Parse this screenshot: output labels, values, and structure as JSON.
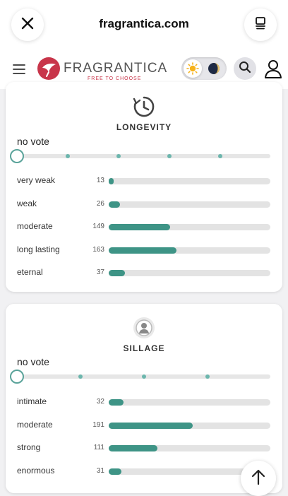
{
  "browser": {
    "url": "fragrantica.com"
  },
  "header": {
    "logo_text": "FRAGRANTICA",
    "logo_tagline": "FREE TO CHOOSE"
  },
  "longevity": {
    "title": "LONGEVITY",
    "vote_status": "no vote",
    "rows": [
      {
        "label": "very weak",
        "count": "13",
        "fraction": 0.03
      },
      {
        "label": "weak",
        "count": "26",
        "fraction": 0.07
      },
      {
        "label": "moderate",
        "count": "149",
        "fraction": 0.38
      },
      {
        "label": "long lasting",
        "count": "163",
        "fraction": 0.42
      },
      {
        "label": "eternal",
        "count": "37",
        "fraction": 0.1
      }
    ]
  },
  "sillage": {
    "title": "SILLAGE",
    "vote_status": "no vote",
    "rows": [
      {
        "label": "intimate",
        "count": "32",
        "fraction": 0.09
      },
      {
        "label": "moderate",
        "count": "191",
        "fraction": 0.52
      },
      {
        "label": "strong",
        "count": "111",
        "fraction": 0.3
      },
      {
        "label": "enormous",
        "count": "31",
        "fraction": 0.08
      }
    ]
  },
  "colors": {
    "accent": "#3e9486",
    "brand": "#c8354a"
  }
}
